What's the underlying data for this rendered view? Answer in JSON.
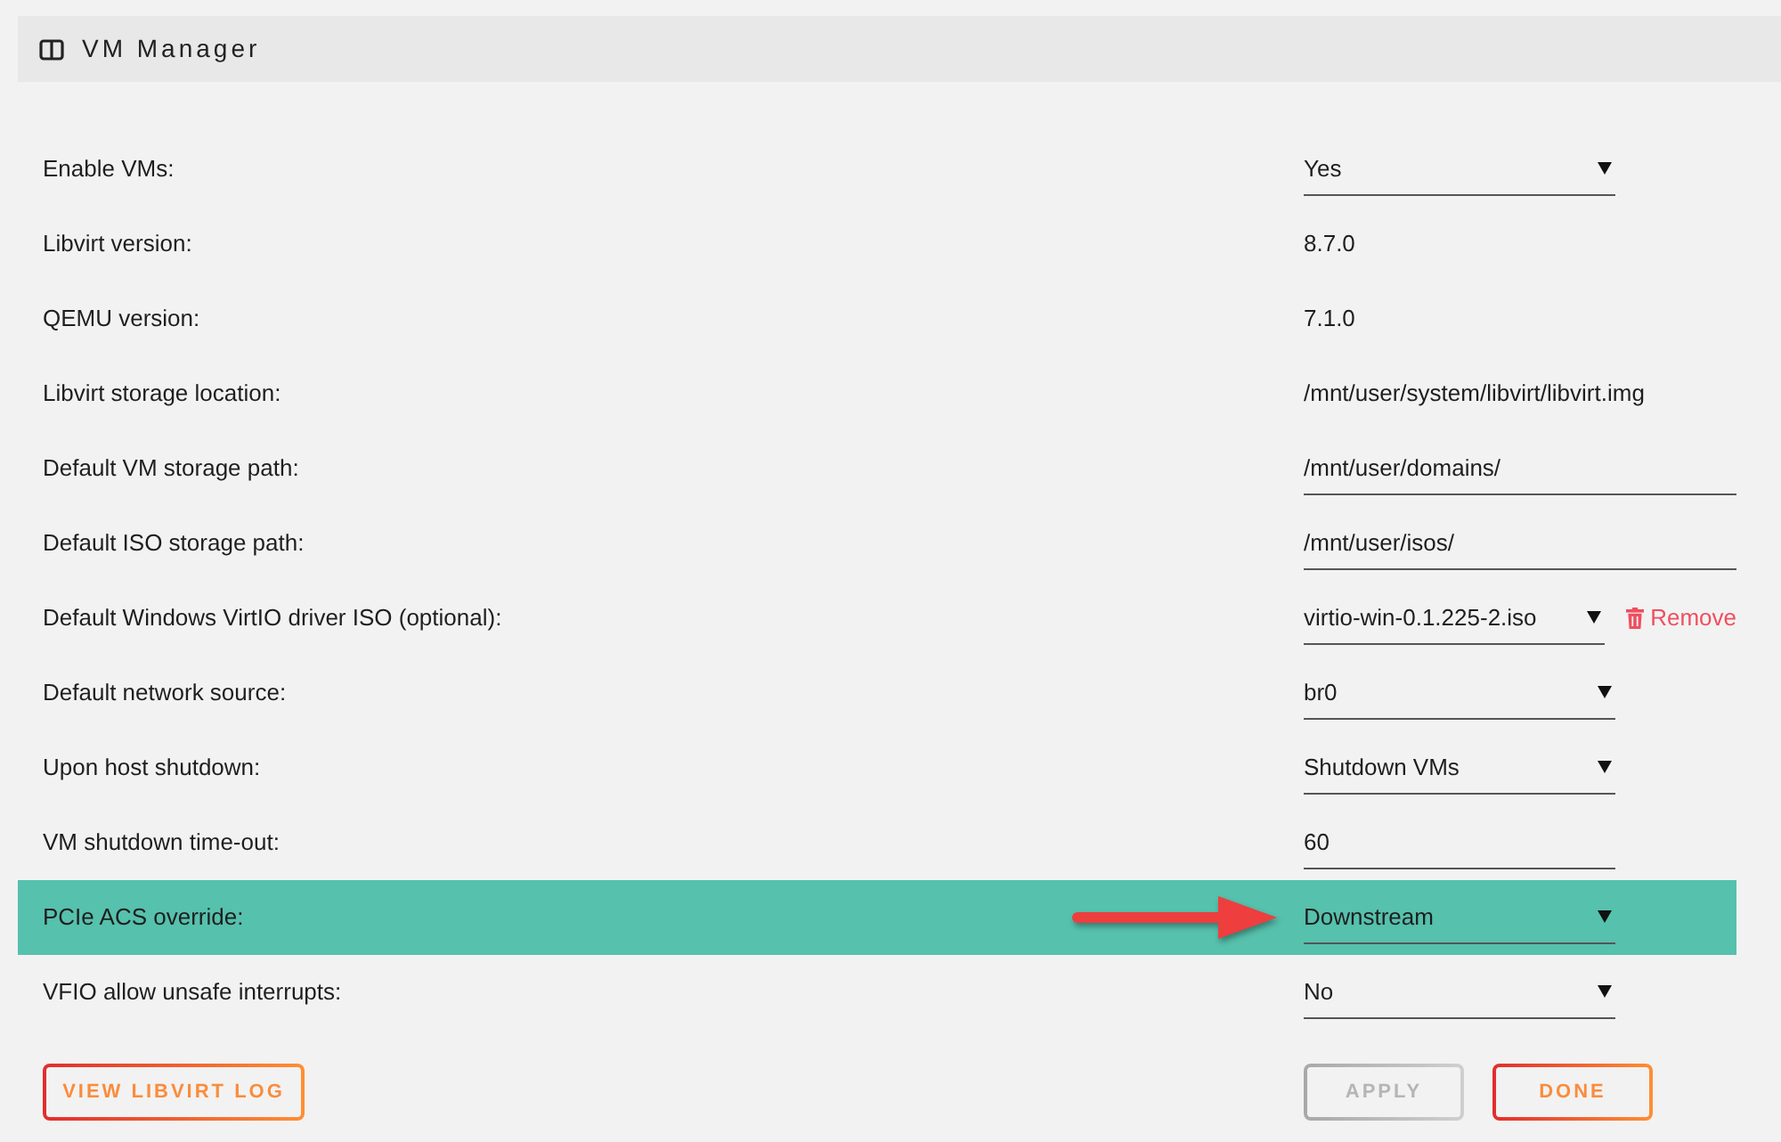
{
  "panel": {
    "title": "VM Manager"
  },
  "settings": [
    {
      "label": "Enable VMs:",
      "kind": "select",
      "value": "Yes",
      "highlighted": false
    },
    {
      "label": "Libvirt version:",
      "kind": "text",
      "value": "8.7.0",
      "highlighted": false
    },
    {
      "label": "QEMU version:",
      "kind": "text",
      "value": "7.1.0",
      "highlighted": false
    },
    {
      "label": "Libvirt storage location:",
      "kind": "text",
      "value": "/mnt/user/system/libvirt/libvirt.img",
      "highlighted": false
    },
    {
      "label": "Default VM storage path:",
      "kind": "input",
      "value": "/mnt/user/domains/",
      "highlighted": false
    },
    {
      "label": "Default ISO storage path:",
      "kind": "input",
      "value": "/mnt/user/isos/",
      "highlighted": false
    },
    {
      "label": "Default Windows VirtIO driver ISO (optional):",
      "kind": "select",
      "value": "virtio-win-0.1.225-2.iso",
      "action": "Remove",
      "highlighted": false
    },
    {
      "label": "Default network source:",
      "kind": "select",
      "value": "br0",
      "highlighted": false
    },
    {
      "label": "Upon host shutdown:",
      "kind": "select",
      "value": "Shutdown VMs",
      "highlighted": false
    },
    {
      "label": "VM shutdown time-out:",
      "kind": "shortinput",
      "value": "60",
      "highlighted": false
    },
    {
      "label": "PCIe ACS override:",
      "kind": "select",
      "value": "Downstream",
      "highlighted": true
    },
    {
      "label": "VFIO allow unsafe interrupts:",
      "kind": "select",
      "value": "No",
      "highlighted": false
    }
  ],
  "footer": {
    "left_buttons": [
      {
        "label": "VIEW LIBVIRT LOG",
        "disabled": false
      }
    ],
    "right_buttons": [
      {
        "label": "APPLY",
        "disabled": true
      },
      {
        "label": "DONE",
        "disabled": false
      }
    ]
  }
}
